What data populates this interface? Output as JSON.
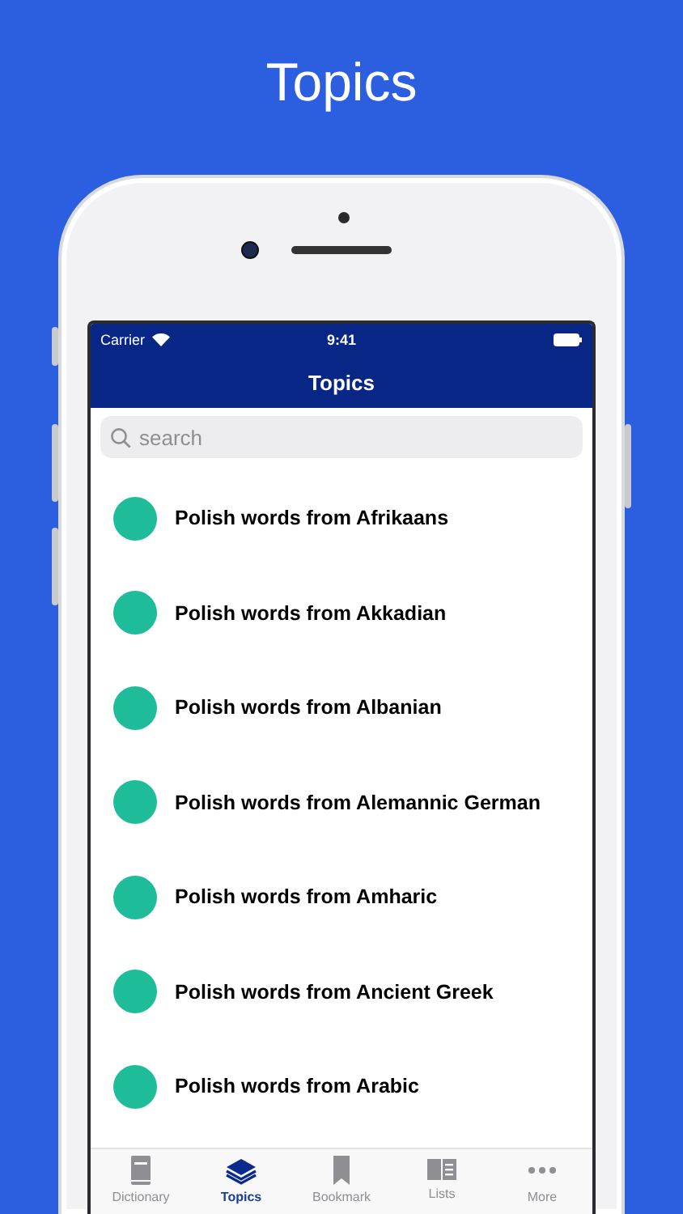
{
  "headline": "Topics",
  "status_bar": {
    "carrier": "Carrier",
    "time": "9:41"
  },
  "nav_bar": {
    "title": "Topics"
  },
  "search": {
    "placeholder": "search"
  },
  "topics": [
    {
      "label": "Polish words from Afrikaans"
    },
    {
      "label": "Polish words from Akkadian"
    },
    {
      "label": "Polish words from Albanian"
    },
    {
      "label": "Polish words from Alemannic German"
    },
    {
      "label": "Polish words from Amharic"
    },
    {
      "label": "Polish words from Ancient Greek"
    },
    {
      "label": "Polish words from Arabic"
    }
  ],
  "tab_bar": [
    {
      "kind": "book",
      "label": "Dictionary",
      "selected": false
    },
    {
      "kind": "stack",
      "label": "Topics",
      "selected": true
    },
    {
      "kind": "bookmark",
      "label": "Bookmark",
      "selected": false
    },
    {
      "kind": "columns",
      "label": "Lists",
      "selected": false
    },
    {
      "kind": "dots",
      "label": "More",
      "selected": false
    }
  ]
}
